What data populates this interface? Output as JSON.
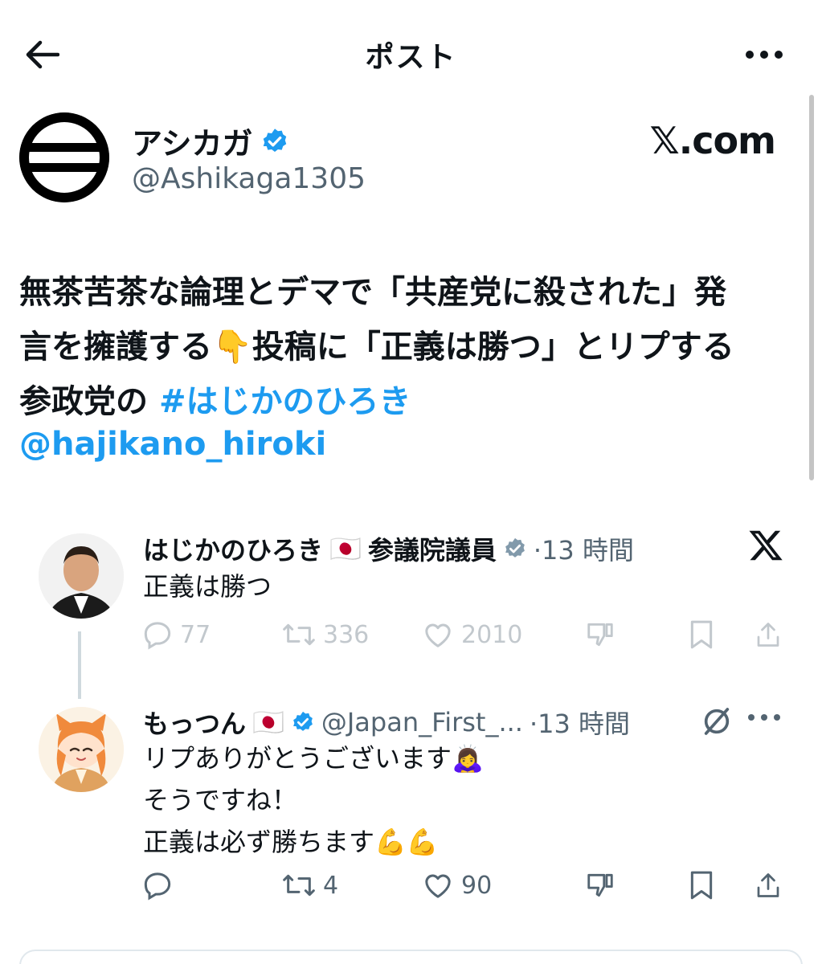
{
  "header": {
    "title": "ポスト",
    "back_icon": "arrow-left-icon",
    "more_icon": "ellipsis-icon"
  },
  "post": {
    "author_name": "アシカガ",
    "author_handle": "@Ashikaga1305",
    "source": "𝕏.com",
    "text_line1": "無茶苦茶な論理とデマで「共産党に殺された」発",
    "text_line2_a": "言を擁護する",
    "text_line2_emoji": "👇",
    "text_line2_b": "投稿に「正義は勝つ」とリプする",
    "text_line3": "参政党の ",
    "hashtag": "#はじかのひろき",
    "mention": "@hajikano_hiroki"
  },
  "replies": [
    {
      "name": "はじかのひろき",
      "flag": "🇯🇵",
      "title": "参議院議員",
      "time": "·13 時間",
      "body": [
        "正義は勝つ"
      ],
      "replies": "77",
      "reposts": "336",
      "likes": "2010"
    },
    {
      "name": "もっつん",
      "flag": "🇯🇵",
      "handle": "@Japan_First_...",
      "time": "·13 時間",
      "body": [
        "リプありがとうございます",
        "そうですね！",
        "正義は必ず勝ちます"
      ],
      "emoji_bow": "🙇‍♀️",
      "emoji_muscle": "💪💪",
      "replies": "",
      "reposts": "4",
      "likes": "90"
    }
  ],
  "colors": {
    "accent": "#1d9bf0",
    "muted": "#536471",
    "verified": "#1d9bf0"
  }
}
